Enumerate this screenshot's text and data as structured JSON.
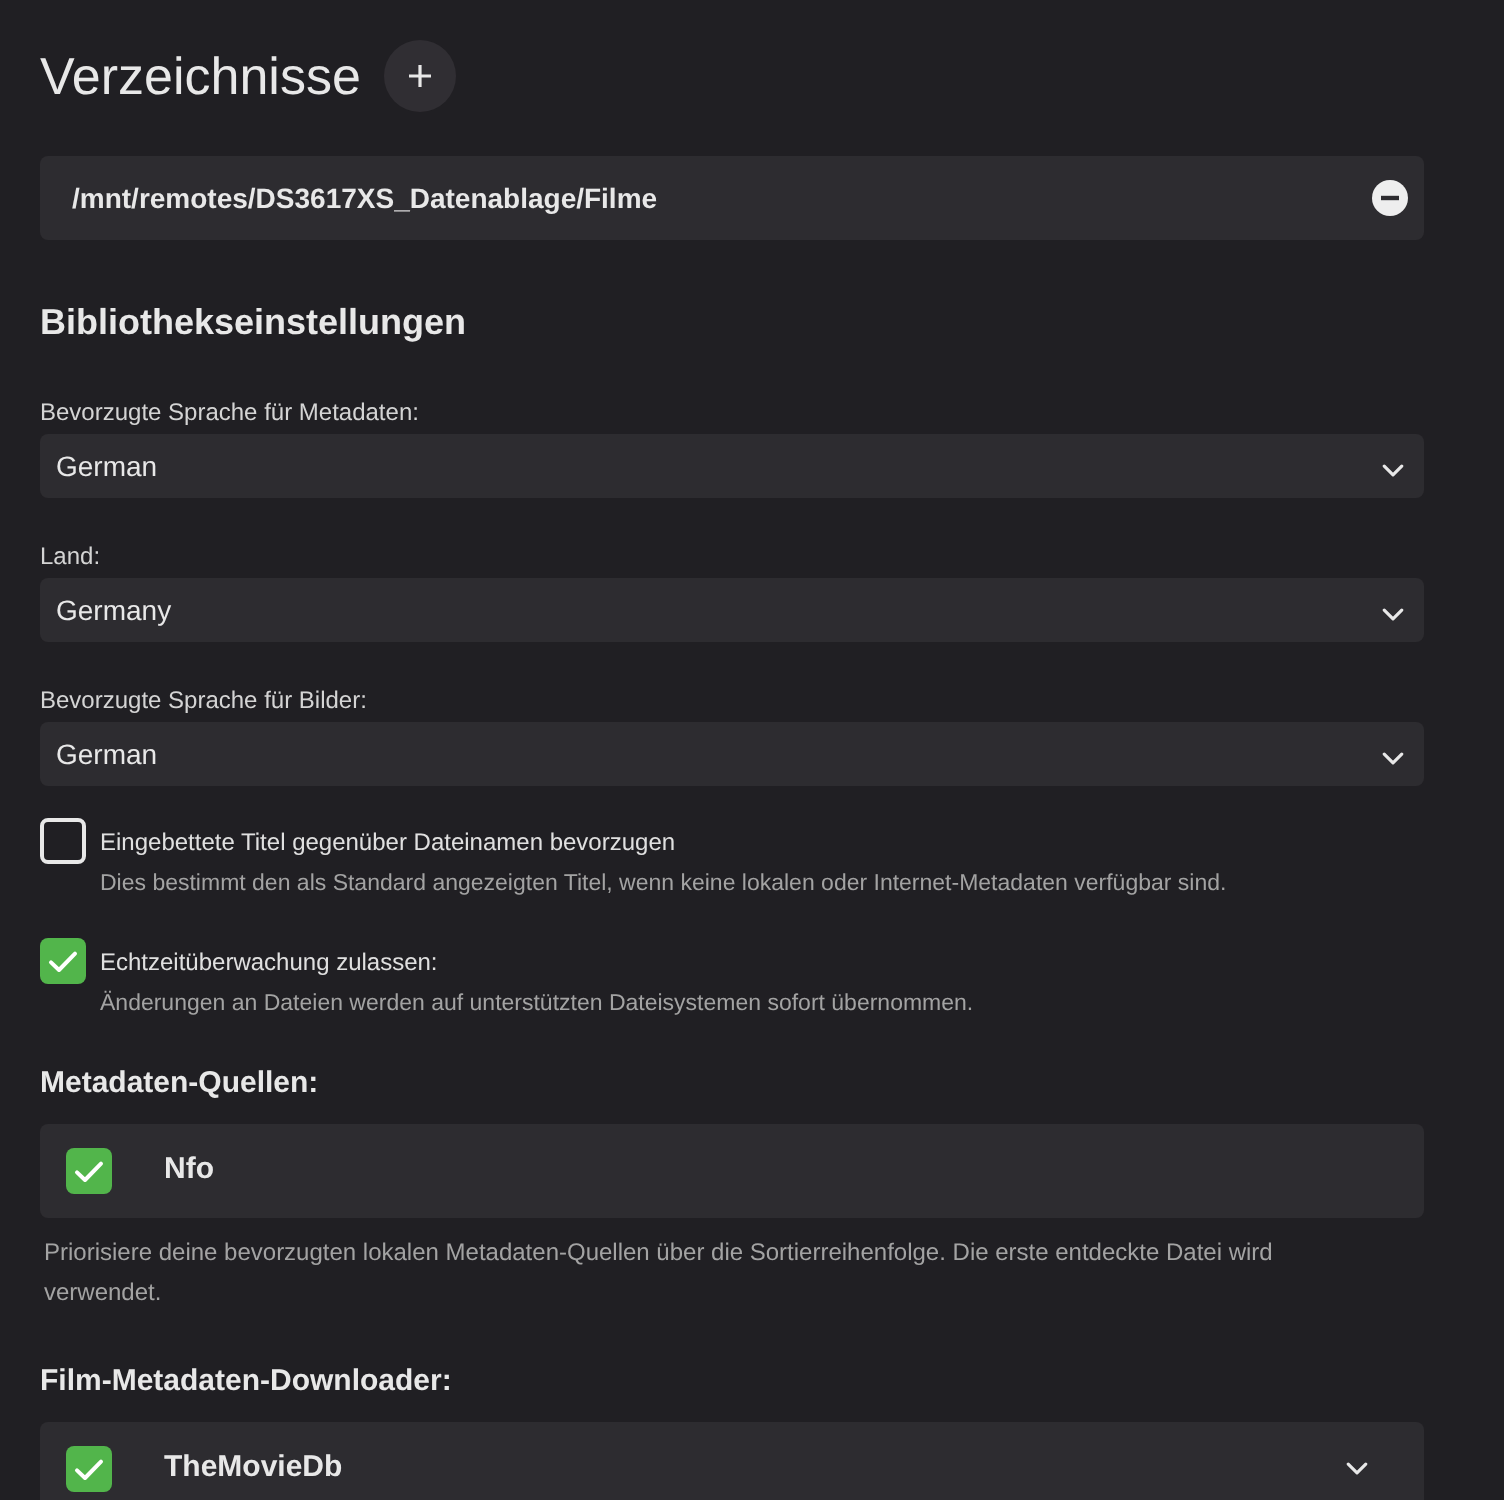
{
  "directories": {
    "title": "Verzeichnisse",
    "paths": [
      {
        "path": "/mnt/remotes/DS3617XS_Datenablage/Filme"
      }
    ]
  },
  "library_settings": {
    "title": "Bibliothekseinstellungen",
    "selects": [
      {
        "label": "Bevorzugte Sprache für Metadaten:",
        "value": "German"
      },
      {
        "label": "Land:",
        "value": "Germany"
      },
      {
        "label": "Bevorzugte Sprache für Bilder:",
        "value": "German"
      }
    ],
    "checkboxes": [
      {
        "label": "Eingebettete Titel gegenüber Dateinamen bevorzugen",
        "description": "Dies bestimmt den als Standard angezeigten Titel, wenn keine lokalen oder Internet-Metadaten verfügbar sind.",
        "checked": false
      },
      {
        "label": "Echtzeitüberwachung zulassen:",
        "description": "Änderungen an Dateien werden auf unterstützten Dateisystemen sofort übernommen.",
        "checked": true
      }
    ]
  },
  "metadata_sources": {
    "title": "Metadaten-Quellen:",
    "items": [
      {
        "name": "Nfo",
        "checked": true,
        "expandable": false
      }
    ],
    "help": "Priorisiere deine bevorzugten lokalen Metadaten-Quellen über die Sortierreihenfolge. Die erste entdeckte Datei wird verwendet."
  },
  "movie_metadata_downloaders": {
    "title": "Film-Metadaten-Downloader:",
    "items": [
      {
        "name": "TheMovieDb",
        "checked": true,
        "expandable": true
      }
    ]
  }
}
